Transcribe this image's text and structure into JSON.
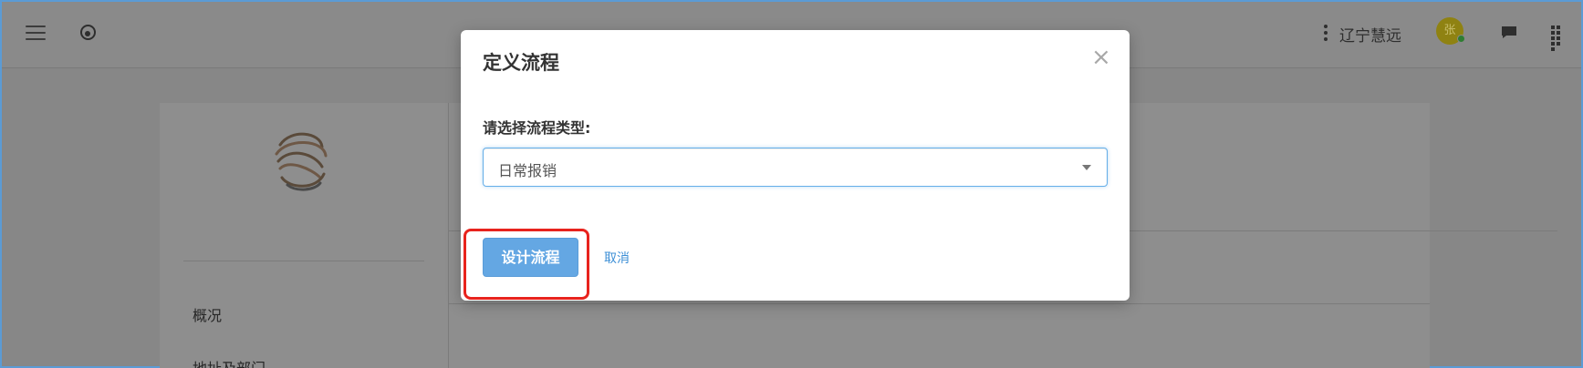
{
  "header": {
    "org_name": "辽宁慧远",
    "avatar_initial": "张"
  },
  "sidebar": {
    "nav_items": [
      "概况",
      "地址及部门"
    ]
  },
  "modal": {
    "title": "定义流程",
    "close_symbol": "×",
    "field_label": "请选择流程类型:",
    "select_value": "日常报销",
    "primary_button": "设计流程",
    "cancel_link": "取消"
  },
  "colors": {
    "primary": "#64a7e3",
    "link": "#3d8fd6",
    "highlight": "#e8231d",
    "overlay": "#878787"
  },
  "icons": {
    "menu": "menu-icon",
    "logo": "app-logo-icon",
    "more": "more-vertical-icon",
    "chat": "chat-icon",
    "apps": "apps-grid-icon",
    "company_logo": "company-logo-icon",
    "caret": "caret-down-icon"
  }
}
